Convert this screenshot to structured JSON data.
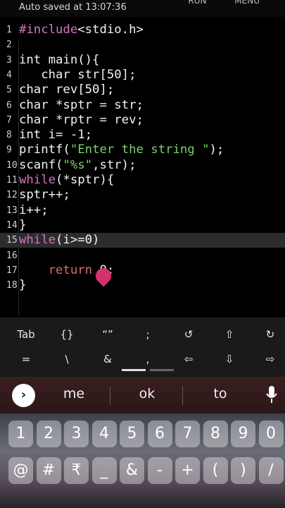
{
  "status": {
    "autosave": "Auto saved at 13:07:36",
    "actions": [
      "RUN",
      "MENU"
    ]
  },
  "code_lines": [
    {
      "n": "1",
      "text": "#include<stdio.h>"
    },
    {
      "n": "2",
      "text": ""
    },
    {
      "n": "3",
      "text": "int main(){"
    },
    {
      "n": "4",
      "text": "   char str[50];"
    },
    {
      "n": "5",
      "text": "char rev[50];"
    },
    {
      "n": "6",
      "text": "char *sptr = str;"
    },
    {
      "n": "7",
      "text": "char *rptr = rev;"
    },
    {
      "n": "8",
      "text": "int i= -1;"
    },
    {
      "n": "9",
      "text": "printf(\"Enter the string \");"
    },
    {
      "n": "10",
      "text": "scanf(\"%s\",str);"
    },
    {
      "n": "11",
      "text": "while(*sptr){"
    },
    {
      "n": "12",
      "text": "sptr++;"
    },
    {
      "n": "13",
      "text": "i++;"
    },
    {
      "n": "14",
      "text": "}"
    },
    {
      "n": "15",
      "text": "while(i>=0)"
    },
    {
      "n": "16",
      "text": ""
    },
    {
      "n": "17",
      "text": "    return 0;"
    },
    {
      "n": "18",
      "text": "}"
    }
  ],
  "symbols_row1": [
    "Tab",
    "{}",
    "“”",
    ";",
    "↺",
    "⇧",
    "↻"
  ],
  "symbols_row2": [
    "=",
    "\\",
    "&",
    ",",
    "⇦",
    "⇩",
    "⇨"
  ],
  "suggestions": [
    "me",
    "ok",
    "to"
  ],
  "keys_row1": [
    "1",
    "2",
    "3",
    "4",
    "5",
    "6",
    "7",
    "8",
    "9",
    "0"
  ],
  "keys_row2": [
    "@",
    "#",
    "₹",
    "_",
    "&",
    "-",
    "+",
    "(",
    ")",
    "/"
  ]
}
